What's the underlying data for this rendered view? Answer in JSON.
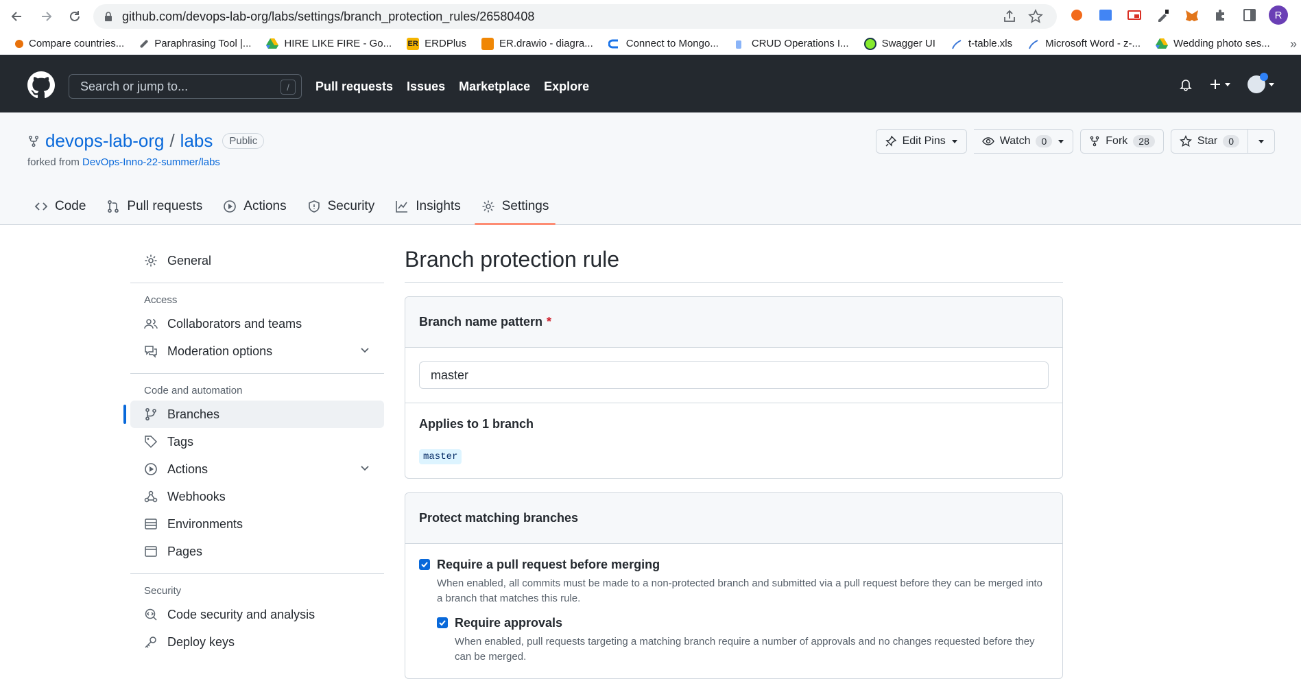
{
  "browser": {
    "url": "github.com/devops-lab-org/labs/settings/branch_protection_rules/26580408",
    "bookmarks": [
      {
        "label": "Compare countries...",
        "color": "#e8710a"
      },
      {
        "label": "Paraphrasing Tool |...",
        "color": "#5f6368"
      },
      {
        "label": "HIRE LIKE FIRE - Go...",
        "color": "#34a853"
      },
      {
        "label": "ERDPlus",
        "color": "#f4b400"
      },
      {
        "label": "ER.drawio - diagra...",
        "color": "#f08705"
      },
      {
        "label": "Connect to Mongo...",
        "color": "#1a73e8"
      },
      {
        "label": "CRUD Operations I...",
        "color": "#4285f4"
      },
      {
        "label": "Swagger UI",
        "color": "#85ea2d"
      },
      {
        "label": "t-table.xls",
        "color": "#3c78d8"
      },
      {
        "label": "Microsoft Word - z-...",
        "color": "#3c78d8"
      },
      {
        "label": "Wedding photo ses...",
        "color": "#34a853"
      }
    ],
    "more": "»"
  },
  "header": {
    "search_placeholder": "Search or jump to...",
    "search_key": "/",
    "nav": [
      "Pull requests",
      "Issues",
      "Marketplace",
      "Explore"
    ]
  },
  "repo": {
    "owner": "devops-lab-org",
    "separator": "/",
    "name": "labs",
    "visibility": "Public",
    "forked_prefix": "forked from ",
    "forked_from": "DevOps-Inno-22-summer/labs",
    "edit_pins": "Edit Pins",
    "watch": "Watch",
    "watch_count": "0",
    "fork": "Fork",
    "fork_count": "28",
    "star": "Star",
    "star_count": "0",
    "tabs": [
      {
        "label": "Code",
        "icon": "code-icon"
      },
      {
        "label": "Pull requests",
        "icon": "pull-request-icon"
      },
      {
        "label": "Actions",
        "icon": "play-icon"
      },
      {
        "label": "Security",
        "icon": "shield-icon"
      },
      {
        "label": "Insights",
        "icon": "graph-icon"
      },
      {
        "label": "Settings",
        "icon": "gear-icon",
        "selected": true
      }
    ]
  },
  "sidebar": {
    "general": "General",
    "access_heading": "Access",
    "collaborators": "Collaborators and teams",
    "moderation": "Moderation options",
    "code_heading": "Code and automation",
    "branches": "Branches",
    "tags": "Tags",
    "actions": "Actions",
    "webhooks": "Webhooks",
    "environments": "Environments",
    "pages": "Pages",
    "security_heading": "Security",
    "code_security": "Code security and analysis",
    "deploy_keys": "Deploy keys"
  },
  "main": {
    "title": "Branch protection rule",
    "pattern_label": "Branch name pattern",
    "required_mark": "*",
    "pattern_value": "master",
    "applies_label": "Applies to 1 branch",
    "branch_chip": "master",
    "protect_label": "Protect matching branches",
    "rules": [
      {
        "title": "Require a pull request before merging",
        "desc": "When enabled, all commits must be made to a non-protected branch and submitted via a pull request before they can be merged into a branch that matches this rule.",
        "checked": true
      },
      {
        "title": "Require approvals",
        "desc": "When enabled, pull requests targeting a matching branch require a number of approvals and no changes requested before they can be merged.",
        "checked": true
      }
    ]
  }
}
